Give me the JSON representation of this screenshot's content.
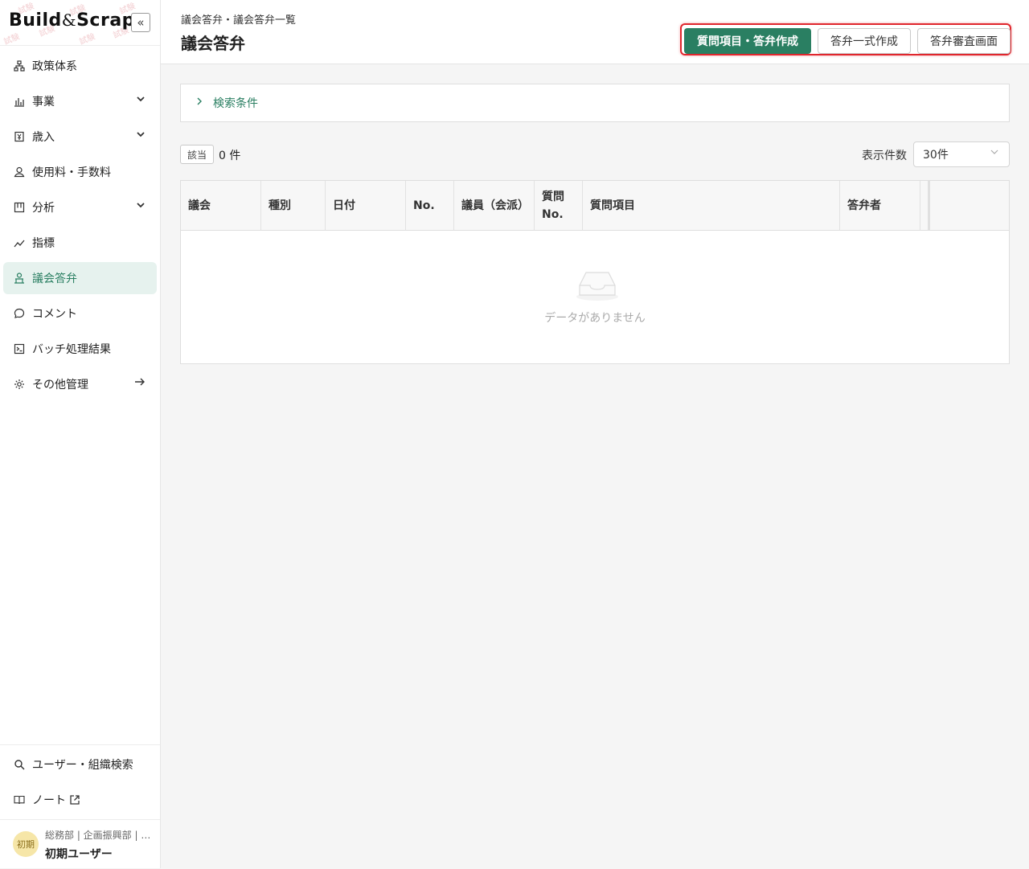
{
  "brand": {
    "logo_left": "Build",
    "logo_amp": "&",
    "logo_right": "Scrap",
    "watermark": "試験"
  },
  "sidebar": {
    "collapse_glyph": "«",
    "items": [
      {
        "label": "政策体系",
        "icon": "hierarchy-icon",
        "has_chevron": false
      },
      {
        "label": "事業",
        "icon": "bar-chart-icon",
        "has_chevron": true
      },
      {
        "label": "歳入",
        "icon": "revenue-icon",
        "has_chevron": true
      },
      {
        "label": "使用料・手数料",
        "icon": "fee-icon",
        "has_chevron": false
      },
      {
        "label": "分析",
        "icon": "analysis-icon",
        "has_chevron": true
      },
      {
        "label": "指標",
        "icon": "trend-icon",
        "has_chevron": false
      },
      {
        "label": "議会答弁",
        "icon": "podium-icon",
        "has_chevron": false,
        "active": true
      },
      {
        "label": "コメント",
        "icon": "comment-icon",
        "has_chevron": false
      },
      {
        "label": "バッチ処理結果",
        "icon": "terminal-icon",
        "has_chevron": false
      },
      {
        "label": "その他管理",
        "icon": "gear-icon",
        "has_arrow": true
      }
    ],
    "bottom_items": [
      {
        "label": "ユーザー・組織検索",
        "icon": "search-icon"
      },
      {
        "label": "ノート",
        "icon": "book-icon"
      }
    ],
    "user": {
      "avatar_text": "初期",
      "dept": "総務部 | 企画振興部 | …",
      "name": "初期ユーザー"
    }
  },
  "header": {
    "breadcrumb": "議会答弁・議会答弁一覧",
    "title": "議会答弁",
    "buttons": {
      "create_question": "質問項目・答弁作成",
      "bulk_create": "答弁一式作成",
      "review": "答弁審査画面"
    }
  },
  "search": {
    "label": "検索条件"
  },
  "results": {
    "badge": "該当",
    "count": "0 件",
    "per_page_label": "表示件数",
    "per_page_value": "30件"
  },
  "table": {
    "columns": [
      "議会",
      "種別",
      "日付",
      "No.",
      "議員（会派）",
      "質問\nNo.",
      "質問項目",
      "答弁者",
      "‥"
    ],
    "empty_text": "データがありません"
  },
  "colors": {
    "primary": "#2a7f62",
    "active_bg": "#e6f2ee",
    "highlight_border": "#e0262d"
  }
}
